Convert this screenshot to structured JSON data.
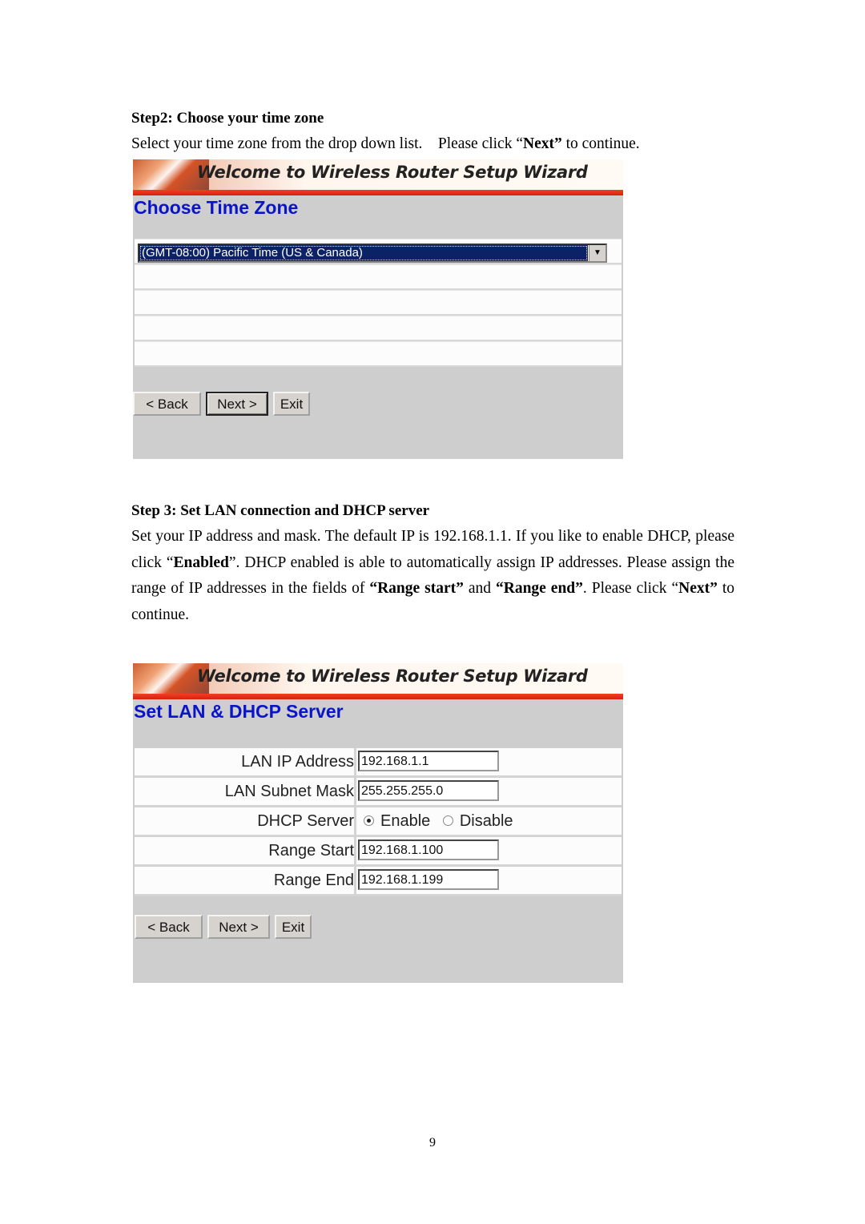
{
  "step2": {
    "heading": "Step2: Choose your time zone",
    "instruction_prefix": "Select your time zone from the drop down list.    Please click “",
    "instruction_bold": "Next”",
    "instruction_suffix": " to continue.",
    "wizard": {
      "banner_title": "Welcome to Wireless Router Setup Wizard",
      "page_title": "Choose Time Zone",
      "timezone_selected": "(GMT-08:00) Pacific Time (US & Canada)",
      "buttons": {
        "back": "< Back",
        "next": "Next >",
        "exit": "Exit"
      }
    }
  },
  "step3": {
    "heading": "Step 3: Set LAN connection and DHCP server",
    "paragraph": [
      {
        "t": "Set your IP address and mask.    The default IP is 192.168.1.1.    If you like to enable DHCP, please click “",
        "b": false
      },
      {
        "t": "Enabled",
        "b": true
      },
      {
        "t": "”.    DHCP enabled is able to automatically assign IP addresses.    Please assign the range of IP addresses in the fields of ",
        "b": false
      },
      {
        "t": "“Range start”",
        "b": true
      },
      {
        "t": " and ",
        "b": false
      },
      {
        "t": "“Range end”",
        "b": true
      },
      {
        "t": ".    Please click “",
        "b": false
      },
      {
        "t": "Next”",
        "b": true
      },
      {
        "t": " to continue.",
        "b": false
      }
    ],
    "wizard": {
      "banner_title": "Welcome to Wireless Router Setup Wizard",
      "page_title": "Set LAN & DHCP Server",
      "fields": {
        "lan_ip_label": "LAN IP Address",
        "lan_ip_value": "192.168.1.1",
        "subnet_label": "LAN Subnet Mask",
        "subnet_value": "255.255.255.0",
        "dhcp_label": "DHCP Server",
        "dhcp_enable": "Enable",
        "dhcp_disable": "Disable",
        "dhcp_selected": "Enable",
        "range_start_label": "Range Start",
        "range_start_value": "192.168.1.100",
        "range_end_label": "Range End",
        "range_end_value": "192.168.1.199"
      },
      "buttons": {
        "back": "< Back",
        "next": "Next >",
        "exit": "Exit"
      }
    }
  },
  "page_number": "9"
}
